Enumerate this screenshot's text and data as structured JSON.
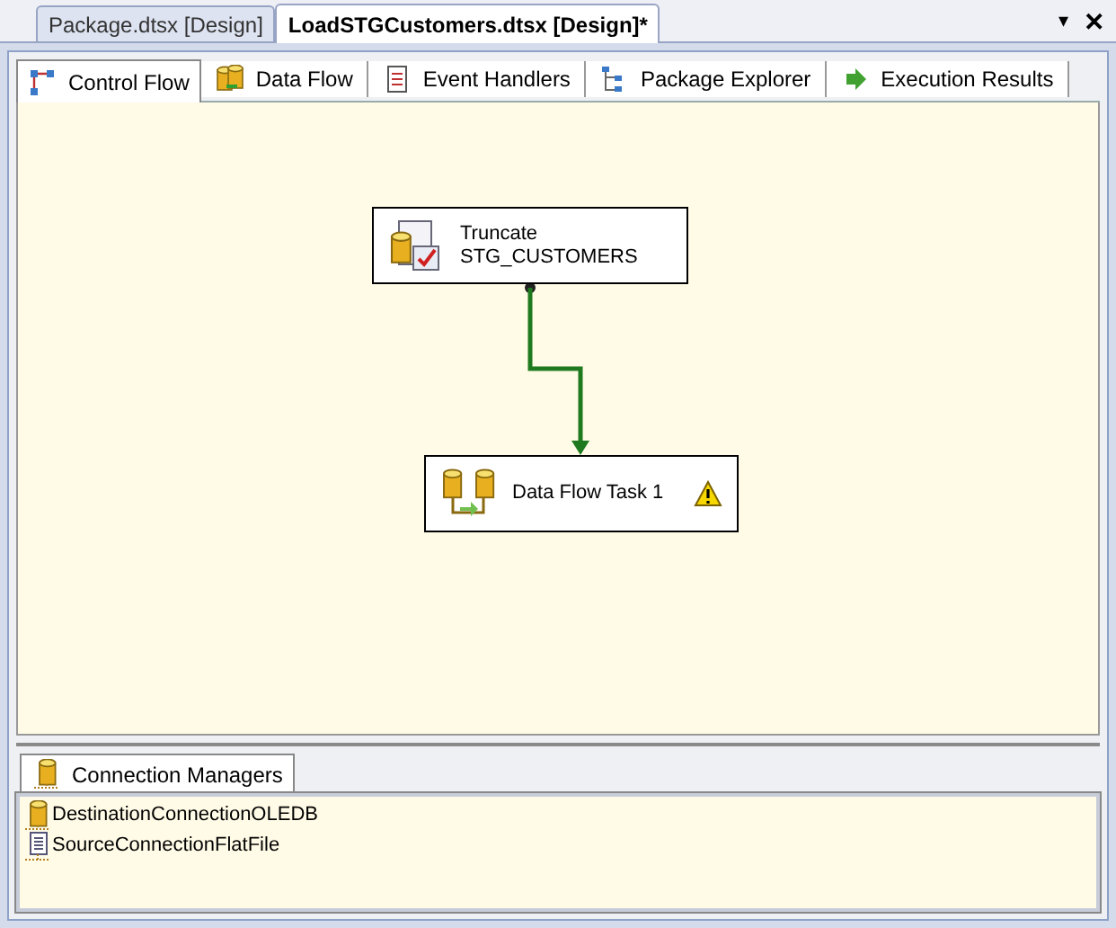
{
  "document_tabs": [
    {
      "label": "Package.dtsx [Design]",
      "selected": false
    },
    {
      "label": "LoadSTGCustomers.dtsx [Design]*",
      "selected": true
    }
  ],
  "window_buttons": [
    "▾",
    "✕"
  ],
  "designer_tabs": [
    {
      "label": "Control Flow",
      "kind": "control",
      "selected": true
    },
    {
      "label": "Data Flow",
      "kind": "dataflow",
      "selected": false
    },
    {
      "label": "Event Handlers",
      "kind": "events",
      "selected": false
    },
    {
      "label": "Package Explorer",
      "kind": "explorer",
      "selected": false
    },
    {
      "label": "Execution Results",
      "kind": "results",
      "selected": false
    }
  ],
  "tasks": [
    {
      "lines": [
        "Truncate",
        "STG_CUSTOMERS"
      ],
      "kind": "sql",
      "warning": false
    },
    {
      "lines": [
        "Data Flow Task 1"
      ],
      "kind": "dataflow",
      "warning": true
    }
  ],
  "connection_managers": {
    "tab": "Connection Managers",
    "items": [
      {
        "name": "DestinationConnectionOLEDB",
        "kind": "oledb"
      },
      {
        "name": "SourceConnectionFlatFile",
        "kind": "flatfile"
      }
    ]
  }
}
